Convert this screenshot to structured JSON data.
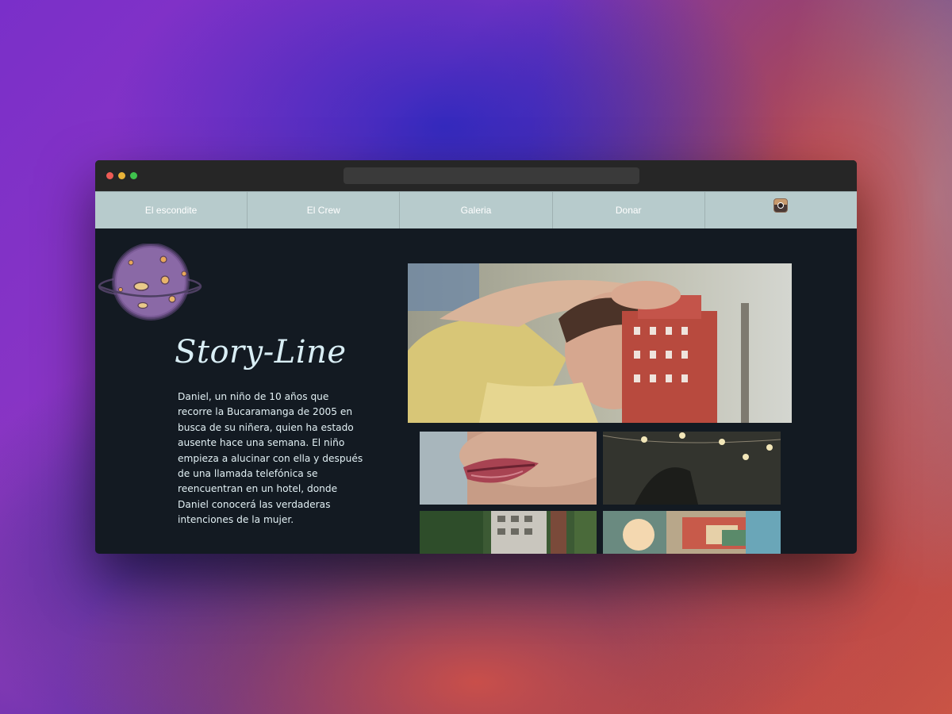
{
  "nav": {
    "items": [
      {
        "label": "El escondite"
      },
      {
        "label": "El Crew"
      },
      {
        "label": "Galeria"
      },
      {
        "label": "Donar"
      }
    ],
    "social_icon": "instagram-icon"
  },
  "main": {
    "title": "Story-Line",
    "synopsis": "Daniel, un niño de 10 años que recorre la Bucaramanga de 2005 en busca de su niñera, quien ha estado ausente hace una semana. El niño empieza a alucinar con ella y después de una llamada telefónica se reencuentran en un hotel, donde Daniel conocerá las verdaderas intenciones de la mujer."
  },
  "colors": {
    "nav_background": "#b7cbcc",
    "page_background": "#131a22",
    "titlebar": "#262626",
    "text": "#e2f0f4"
  }
}
